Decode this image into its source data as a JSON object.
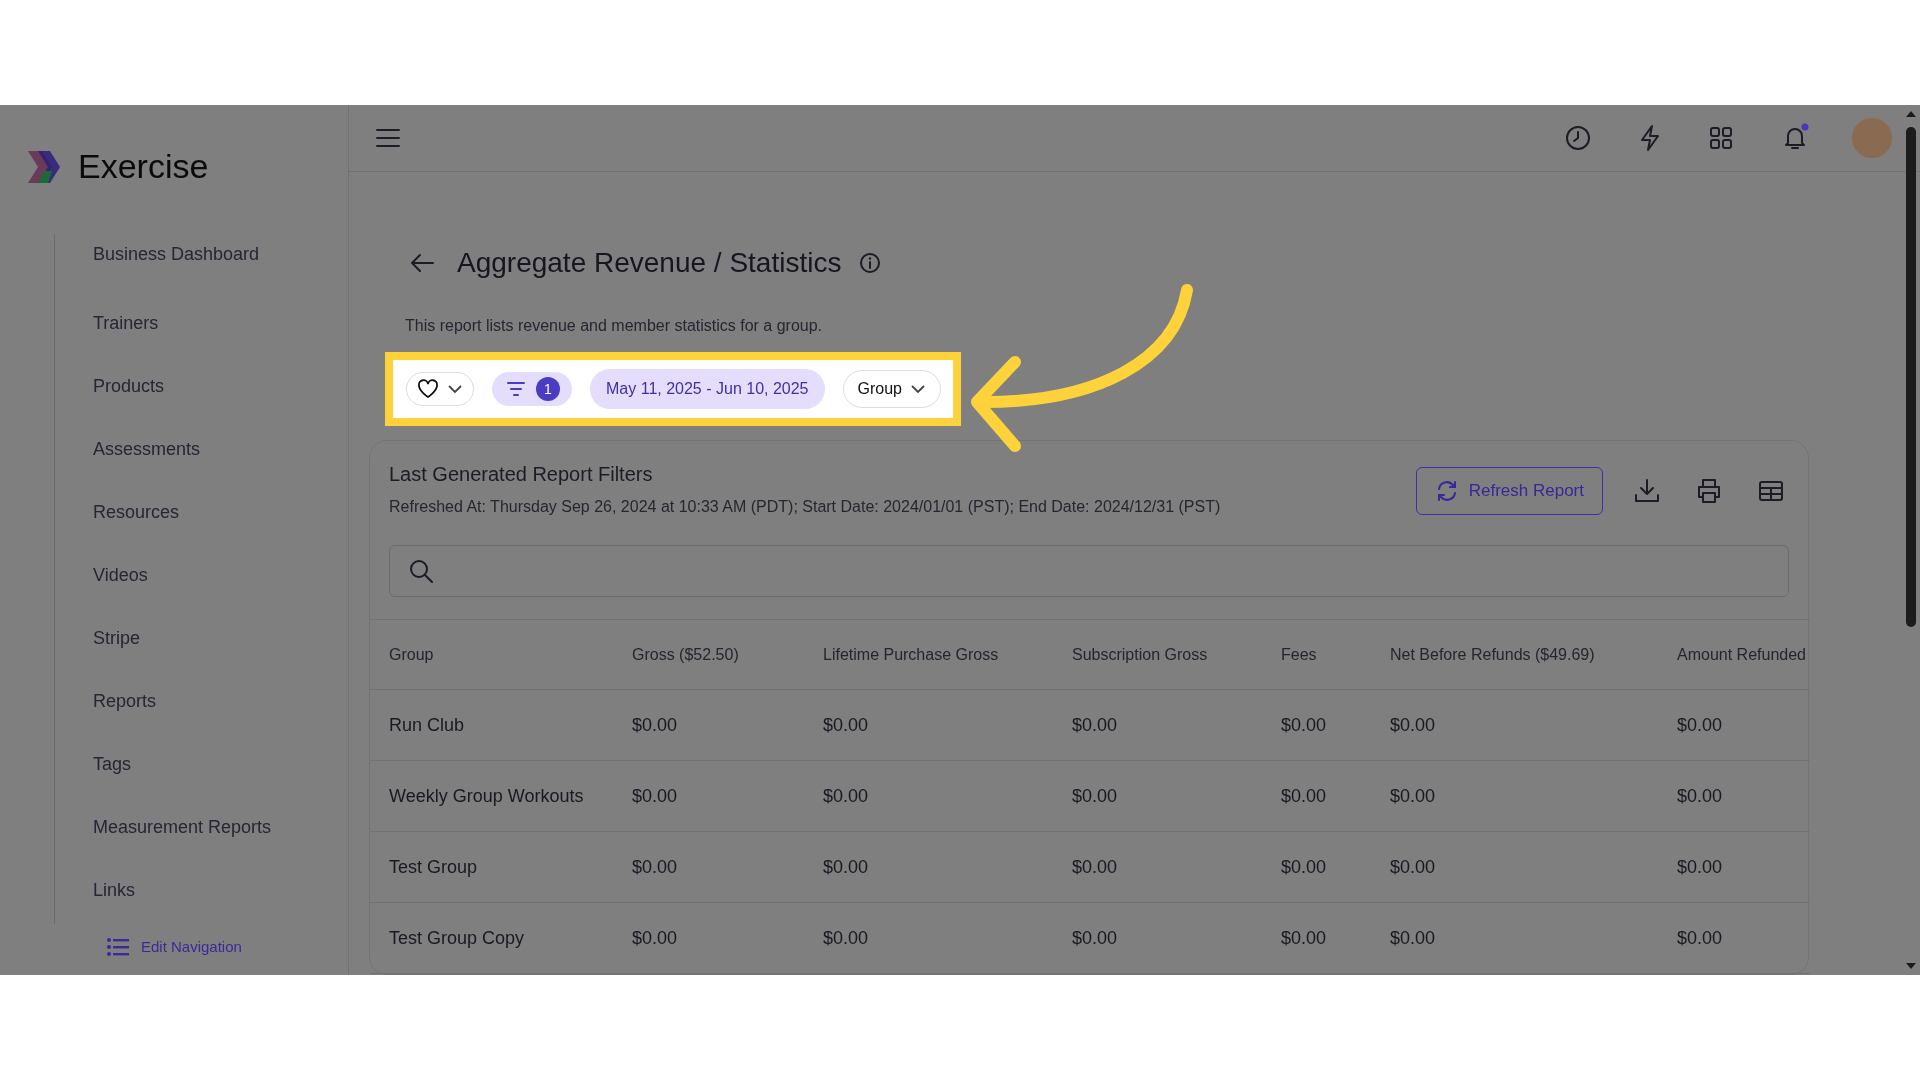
{
  "app": {
    "name": "Exercise"
  },
  "sidebar": {
    "items": [
      {
        "label": "Business Dashboard"
      },
      {
        "label": "Trainers"
      },
      {
        "label": "Products"
      },
      {
        "label": "Assessments"
      },
      {
        "label": "Resources"
      },
      {
        "label": "Videos"
      },
      {
        "label": "Stripe"
      },
      {
        "label": "Reports"
      },
      {
        "label": "Tags"
      },
      {
        "label": "Measurement Reports"
      },
      {
        "label": "Links"
      }
    ],
    "edit_link": "Edit Navigation"
  },
  "header": {
    "notifications_unread": true
  },
  "page": {
    "title": "Aggregate Revenue / Statistics",
    "description": "This report lists revenue and member statistics for a group."
  },
  "filters": {
    "filter_count": "1",
    "date_range": "May 11, 2025 - Jun 10, 2025",
    "group_by": "Group"
  },
  "report": {
    "title": "Last Generated Report Filters",
    "refreshed": "Refreshed At: Thursday Sep 26, 2024 at 10:33 AM (PDT); Start Date: 2024/01/01 (PST); End Date: 2024/12/31 (PST)",
    "refresh_button": "Refresh Report",
    "table": {
      "columns": [
        "Group",
        "Gross ($52.50)",
        "Lifetime Purchase Gross",
        "Subscription Gross",
        "Fees",
        "Net Before Refunds ($49.69)",
        "Amount Refunded"
      ],
      "rows": [
        [
          "Run Club",
          "$0.00",
          "$0.00",
          "$0.00",
          "$0.00",
          "$0.00",
          "$0.00"
        ],
        [
          "Weekly Group Workouts",
          "$0.00",
          "$0.00",
          "$0.00",
          "$0.00",
          "$0.00",
          "$0.00"
        ],
        [
          "Test Group",
          "$0.00",
          "$0.00",
          "$0.00",
          "$0.00",
          "$0.00",
          "$0.00"
        ],
        [
          "Test Group Copy",
          "$0.00",
          "$0.00",
          "$0.00",
          "$0.00",
          "$0.00",
          "$0.00"
        ]
      ]
    }
  }
}
